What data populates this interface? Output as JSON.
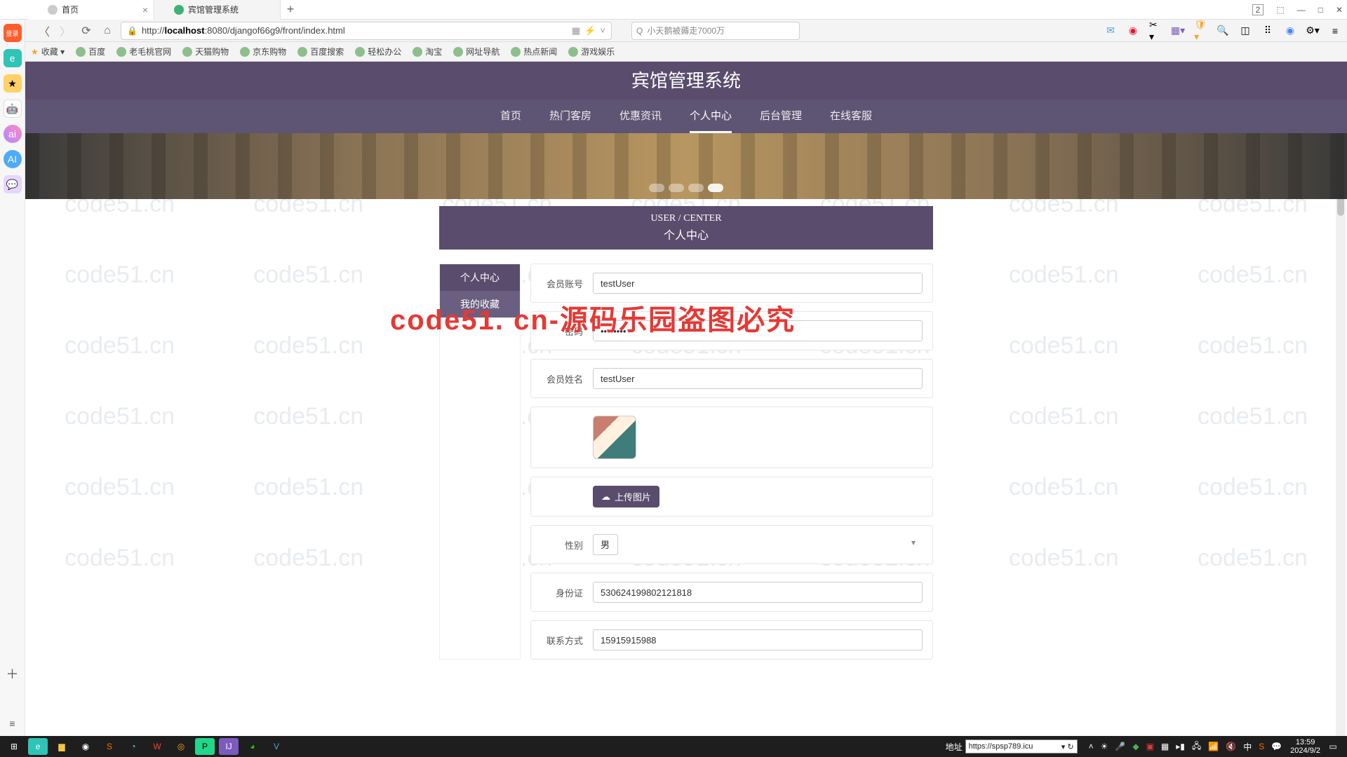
{
  "browser": {
    "tabs": [
      {
        "title": "首页",
        "active": true
      },
      {
        "title": "宾馆管理系统",
        "active": false
      }
    ],
    "url_prefix": "http://",
    "url_host": "localhost",
    "url_rest": ":8080/djangof66g9/front/index.html",
    "search_placeholder": "小天鹅被薅走7000万",
    "win_badge": "2"
  },
  "bookmarks": [
    "收藏 ▾",
    "百度",
    "老毛桃官网",
    "天猫购物",
    "京东购物",
    "百度搜索",
    "轻松办公",
    "淘宝",
    "网址导航",
    "热点新闻",
    "游戏娱乐"
  ],
  "watermark_text": "code51.cn",
  "big_watermark": "code51. cn-源码乐园盗图必究",
  "site": {
    "title": "宾馆管理系统",
    "nav": [
      "首页",
      "热门客房",
      "优惠资讯",
      "个人中心",
      "后台管理",
      "在线客服"
    ],
    "nav_active_index": 3,
    "panel_en": "USER / CENTER",
    "panel_cn": "个人中心",
    "side_items": [
      "个人中心",
      "我的收藏"
    ],
    "form": {
      "account_label": "会员账号",
      "account_value": "testUser",
      "password_label": "密码",
      "password_value": "........",
      "name_label": "会员姓名",
      "name_value": "testUser",
      "upload_btn": "上传图片",
      "gender_label": "性别",
      "gender_value": "男",
      "id_label": "身份证",
      "id_value": "530624199802121818",
      "phone_label": "联系方式",
      "phone_value": "15915915988"
    }
  },
  "taskbar": {
    "addr_label": "地址",
    "addr_value": "https://spsp789.icu",
    "time": "13:59",
    "date": "2024/9/2"
  }
}
